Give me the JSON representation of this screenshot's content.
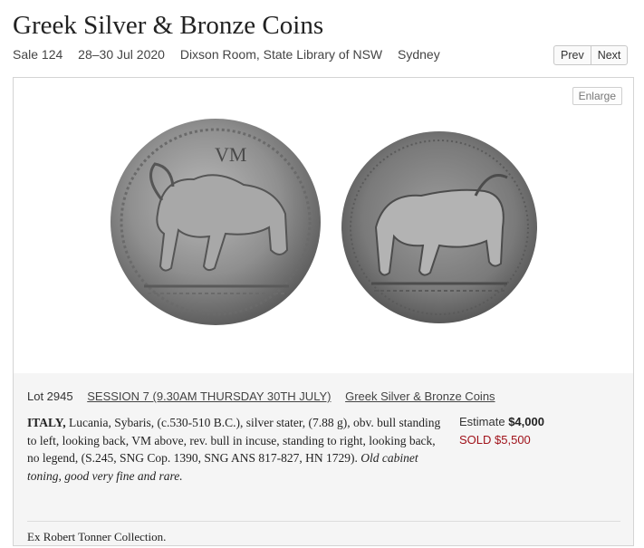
{
  "page": {
    "title": "Greek Silver & Bronze Coins"
  },
  "sale_meta": {
    "sale": "Sale 124",
    "dates": "28–30 Jul 2020",
    "venue": "Dixson Room, State Library of NSW",
    "city": "Sydney"
  },
  "pager": {
    "prev_label": "Prev",
    "next_label": "Next"
  },
  "image_panel": {
    "enlarge_label": "Enlarge",
    "obverse_legend": "VM"
  },
  "lot": {
    "number": "Lot 2945",
    "session_link": "SESSION 7 (9.30AM THURSDAY 30TH JULY)",
    "category_link": "Greek Silver & Bronze Coins",
    "desc_bold": "ITALY,",
    "desc_main": " Lucania, Sybaris, (c.530-510 B.C.), silver stater, (7.88 g), obv. bull standing to left, looking back, VM above, rev. bull in incuse, standing to right, looking back, no legend, (S.245, SNG Cop. 1390, SNG ANS 817-827, HN 1729). ",
    "desc_italic": "Old cabinet toning, good very fine and rare.",
    "estimate_label": "Estimate",
    "estimate_value": "$4,000",
    "sold_text": "SOLD $5,500",
    "provenance": "Ex Robert Tonner Collection."
  },
  "colors": {
    "sold": "#a0121a",
    "info_bg": "#f5f5f5",
    "coin_silver": "#8a8a8a"
  }
}
